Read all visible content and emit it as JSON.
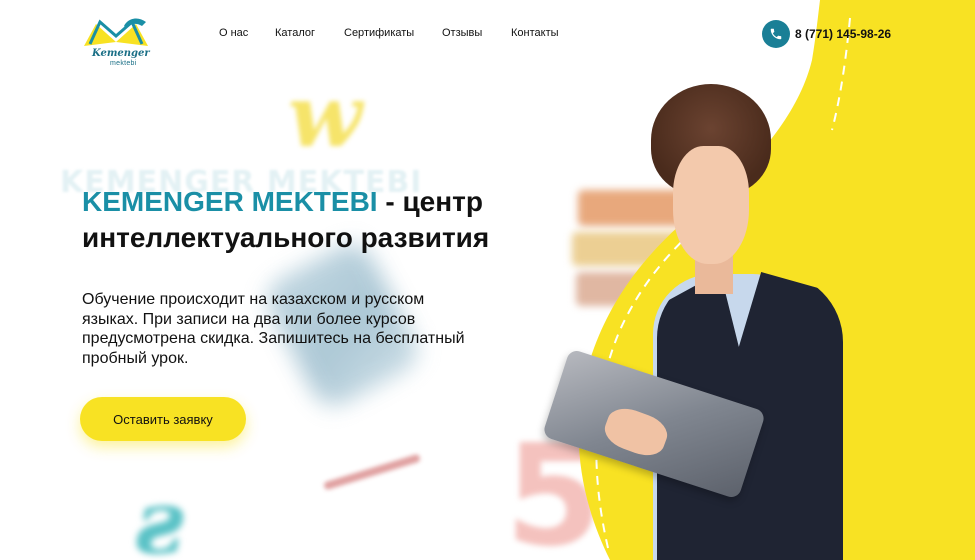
{
  "logo": {
    "line1": "Kemenger",
    "line2": "mektebi"
  },
  "nav": [
    {
      "label": "О нас"
    },
    {
      "label": "Каталог"
    },
    {
      "label": "Сертификаты"
    },
    {
      "label": "Отзывы"
    },
    {
      "label": "Контакты"
    }
  ],
  "phone": {
    "number": "8 (771) 145-98-26",
    "icon": "phone-icon"
  },
  "hero": {
    "brand": "KEMENGER MEKTEBI",
    "title_rest": " - центр интеллектуального развития",
    "ghost_title": "KEMENGER MEKTEBI",
    "description": "Обучение происходит на казахском и русском языках. При записи на два или более курсов предусмотрена скидка. Запишитесь на бесплатный пробный урок.",
    "cta_label": "Оставить заявку"
  },
  "colors": {
    "brand_teal": "#1a8fa6",
    "accent_yellow": "#f8e223",
    "text": "#111111"
  }
}
